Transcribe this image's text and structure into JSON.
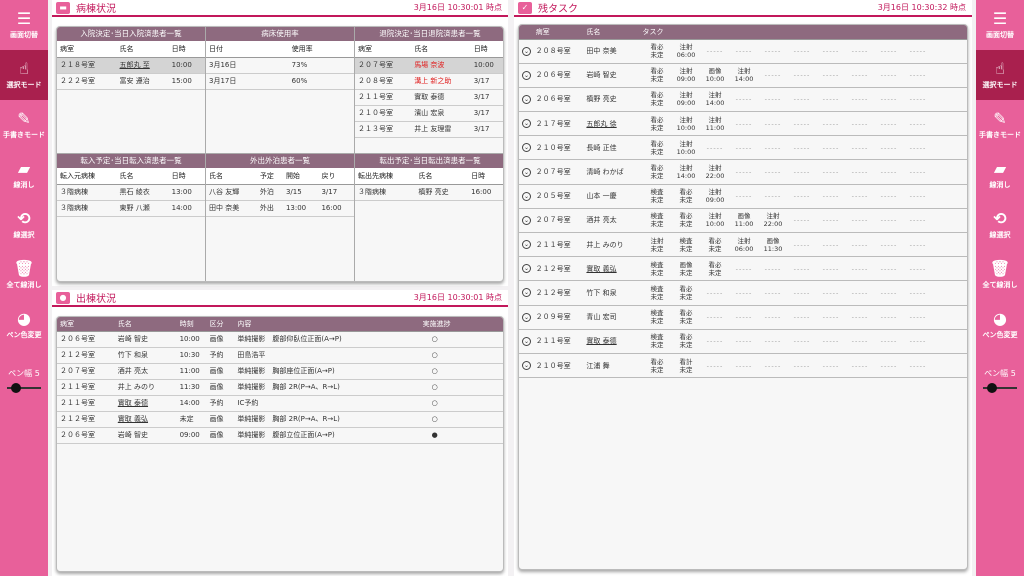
{
  "left_menu": [
    {
      "icon": "menu-icon",
      "label": "画面切替",
      "active": false
    },
    {
      "icon": "pointer-icon",
      "label": "選択モード",
      "active": true
    },
    {
      "icon": "pen-icon",
      "label": "手書きモード",
      "active": false
    },
    {
      "icon": "eraser-icon",
      "label": "線消し",
      "active": false
    },
    {
      "icon": "lasso-icon",
      "label": "線選択",
      "active": false
    },
    {
      "icon": "trash-icon",
      "label": "全て線消し",
      "active": false
    },
    {
      "icon": "palette-icon",
      "label": "ペン色変更",
      "active": false
    }
  ],
  "pen": {
    "label": "ペン幅  5",
    "value": 5
  },
  "ward": {
    "title": "病棟状況",
    "time": "3月16日  10:30:01 時点",
    "admit": {
      "title": "入院決定･当日入院済患者一覧",
      "headers": [
        "病室",
        "氏名",
        "日時"
      ],
      "rows": [
        [
          "２１８号室",
          "五郎丸 至",
          "10:00"
        ],
        [
          "２２２号室",
          "富安 遵治",
          "15:00"
        ]
      ]
    },
    "bed": {
      "title": "病床使用率",
      "headers": [
        "日付",
        "使用率"
      ],
      "rows": [
        [
          "3月16日",
          "73%"
        ],
        [
          "3月17日",
          "60%"
        ]
      ]
    },
    "discharge": {
      "title": "退院決定･当日退院済患者一覧",
      "headers": [
        "病室",
        "氏名",
        "日時"
      ],
      "rows": [
        [
          "２０７号室",
          "馬場 奈波",
          "10:00"
        ],
        [
          "２０８号室",
          "溝上 新之助",
          "3/17"
        ],
        [
          "２１１号室",
          "實取 泰德",
          "3/17"
        ],
        [
          "２１０号室",
          "濱山 宏泉",
          "3/17"
        ],
        [
          "２１３号室",
          "井上 友理雷",
          "3/17"
        ]
      ]
    },
    "transfer_in": {
      "title": "転入予定･当日転入済患者一覧",
      "headers": [
        "転入元病棟",
        "氏名",
        "日時"
      ],
      "rows": [
        [
          "３階病棟",
          "黒石 綾衣",
          "13:00"
        ],
        [
          "３階病棟",
          "東野 八瀬",
          "14:00"
        ]
      ]
    },
    "outing": {
      "title": "外出外泊患者一覧",
      "headers": [
        "氏名",
        "予定",
        "開始",
        "戻り"
      ],
      "rows": [
        [
          "八谷 友輝",
          "外泊",
          "3/15",
          "3/17"
        ],
        [
          "田中 奈美",
          "外出",
          "13:00",
          "16:00"
        ]
      ]
    },
    "transfer_out": {
      "title": "転出予定･当日転出済患者一覧",
      "headers": [
        "転出先病棟",
        "氏名",
        "日時"
      ],
      "rows": [
        [
          "３階病棟",
          "槙野 亮史",
          "16:00"
        ]
      ]
    }
  },
  "outgoing": {
    "title": "出棟状況",
    "time": "3月16日  10:30:01 時点",
    "headers": [
      "病室",
      "氏名",
      "時刻",
      "区分",
      "内容",
      "実施進捗"
    ],
    "rows": [
      [
        "２０６号室",
        "岩崎 智史",
        "10:00",
        "画像",
        "単純撮影　腹部仰臥位正面(A→P)",
        "○"
      ],
      [
        "２１２号室",
        "竹下 和泉",
        "10:30",
        "予約",
        "田島浩平",
        "○"
      ],
      [
        "２０７号室",
        "酒井 亮太",
        "11:00",
        "画像",
        "単純撮影　胸部座位正面(A→P)",
        "○"
      ],
      [
        "２１１号室",
        "井上 みのり",
        "11:30",
        "画像",
        "単純撮影　胸部 2R(P→A、R→L)",
        "○"
      ],
      [
        "２１１号室",
        "實取 泰德",
        "14:00",
        "予約",
        "IC予約",
        "○"
      ],
      [
        "２１２号室",
        "實取 義弘",
        "未定",
        "画像",
        "単純撮影　胸部 2R(P→A、R→L)",
        "○"
      ],
      [
        "２０６号室",
        "岩崎 智史",
        "09:00",
        "画像",
        "単純撮影　腹部立位正面(A→P)",
        "●"
      ]
    ]
  },
  "tasks": {
    "title": "残タスク",
    "time": "3月16日  10:30:32 時点",
    "headers": [
      "病室",
      "氏名",
      "タスク"
    ],
    "rows": [
      {
        "room": "２０８号室",
        "name": "田中 奈美",
        "ul": false,
        "t": [
          [
            "看必",
            "未定"
          ],
          [
            "注射",
            "06:00"
          ]
        ]
      },
      {
        "room": "２０６号室",
        "name": "岩崎 智史",
        "ul": false,
        "t": [
          [
            "看必",
            "未定"
          ],
          [
            "注射",
            "09:00"
          ],
          [
            "画像",
            "10:00"
          ],
          [
            "注射",
            "14:00"
          ]
        ]
      },
      {
        "room": "２０６号室",
        "name": "槙野 亮史",
        "ul": false,
        "t": [
          [
            "看必",
            "未定"
          ],
          [
            "注射",
            "09:00"
          ],
          [
            "注射",
            "14:00"
          ]
        ]
      },
      {
        "room": "２１７号室",
        "name": "五郎丸 徐",
        "ul": true,
        "t": [
          [
            "看必",
            "未定"
          ],
          [
            "注射",
            "10:00"
          ],
          [
            "注射",
            "11:00"
          ]
        ]
      },
      {
        "room": "２１０号室",
        "name": "長崎 正佳",
        "ul": false,
        "t": [
          [
            "看必",
            "未定"
          ],
          [
            "注射",
            "10:00"
          ]
        ]
      },
      {
        "room": "２０７号室",
        "name": "清崎 わかば",
        "ul": false,
        "t": [
          [
            "看必",
            "未定"
          ],
          [
            "注射",
            "14:00"
          ],
          [
            "注射",
            "22:00"
          ]
        ]
      },
      {
        "room": "２０５号室",
        "name": "山本 一慶",
        "ul": false,
        "t": [
          [
            "検査",
            "未定"
          ],
          [
            "看必",
            "未定"
          ],
          [
            "注射",
            "09:00"
          ]
        ]
      },
      {
        "room": "２０７号室",
        "name": "酒井 亮太",
        "ul": false,
        "t": [
          [
            "検査",
            "未定"
          ],
          [
            "看必",
            "未定"
          ],
          [
            "注射",
            "10:00"
          ],
          [
            "画像",
            "11:00"
          ],
          [
            "注射",
            "22:00"
          ]
        ]
      },
      {
        "room": "２１１号室",
        "name": "井上 みのり",
        "ul": false,
        "t": [
          [
            "注射",
            "未定"
          ],
          [
            "検査",
            "未定"
          ],
          [
            "看必",
            "未定"
          ],
          [
            "注射",
            "06:00"
          ],
          [
            "画像",
            "11:30"
          ]
        ]
      },
      {
        "room": "２１２号室",
        "name": "實取 義弘",
        "ul": true,
        "t": [
          [
            "検査",
            "未定"
          ],
          [
            "画像",
            "未定"
          ],
          [
            "看必",
            "未定"
          ]
        ]
      },
      {
        "room": "２１２号室",
        "name": "竹下 和泉",
        "ul": false,
        "t": [
          [
            "検査",
            "未定"
          ],
          [
            "看必",
            "未定"
          ]
        ]
      },
      {
        "room": "２０９号室",
        "name": "青山 宏司",
        "ul": false,
        "t": [
          [
            "検査",
            "未定"
          ],
          [
            "看必",
            "未定"
          ]
        ]
      },
      {
        "room": "２１１号室",
        "name": "實取 泰德",
        "ul": true,
        "t": [
          [
            "検査",
            "未定"
          ],
          [
            "看必",
            "未定"
          ]
        ]
      },
      {
        "room": "２１０号室",
        "name": "江浦 舞",
        "ul": false,
        "t": [
          [
            "看必",
            "未定"
          ],
          [
            "看計",
            "未定"
          ]
        ]
      }
    ]
  }
}
